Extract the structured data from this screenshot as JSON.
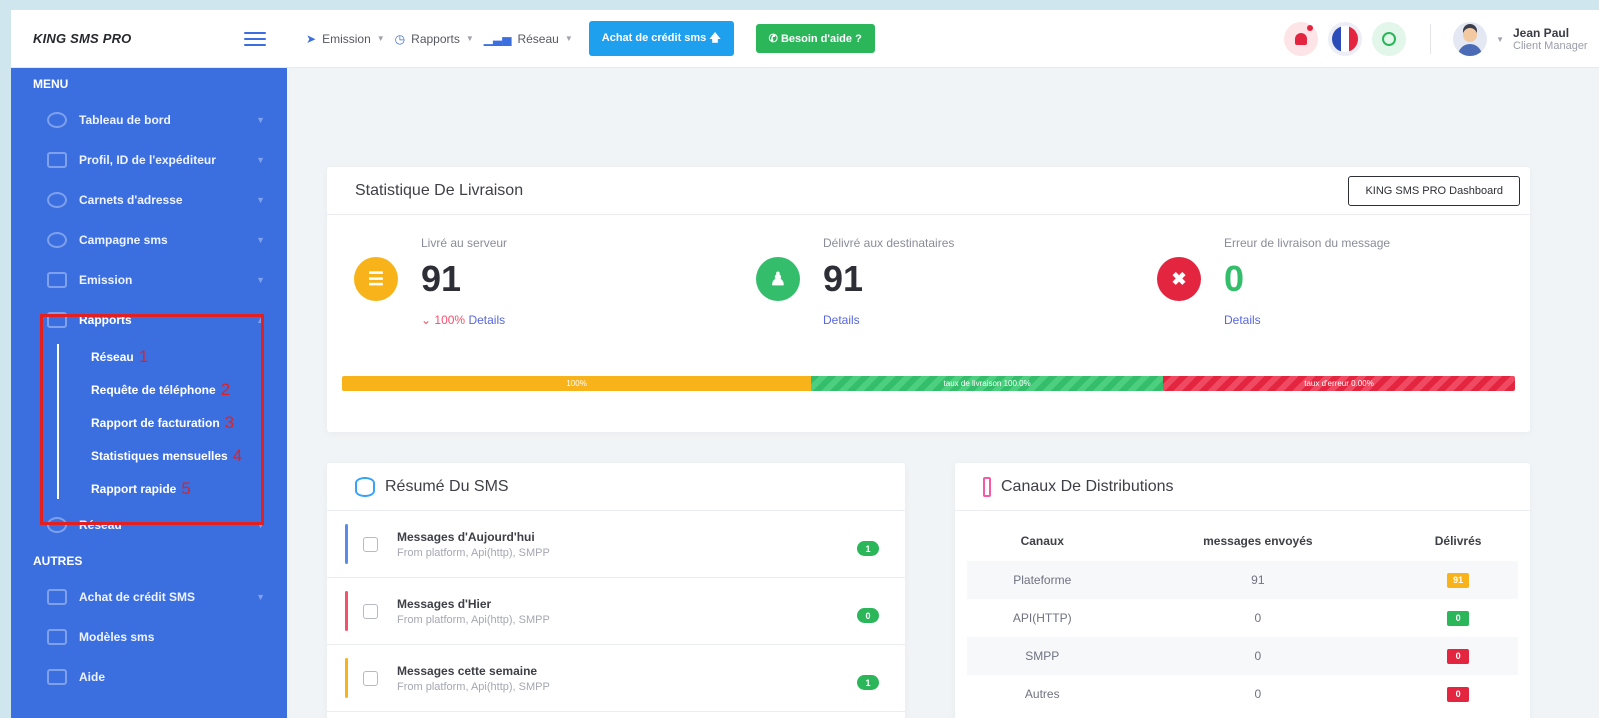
{
  "brand": {
    "name": "KING SMS PRO"
  },
  "topnav": {
    "items": [
      {
        "label": "Emission",
        "icon": "send-icon"
      },
      {
        "label": "Rapports",
        "icon": "clock-icon"
      },
      {
        "label": "Réseau",
        "icon": "signal-icon"
      }
    ],
    "credit_button": "Achat de crédit sms 🡅",
    "help_button": "✆ Besoin d'aide ?"
  },
  "user": {
    "name": "Jean Paul",
    "role": "Client Manager"
  },
  "sidebar": {
    "menu_header": "MENU",
    "items": [
      {
        "label": "Tableau de bord",
        "icon": "bell-icon"
      },
      {
        "label": "Profil, ID de l'expéditeur",
        "icon": "profile-icon"
      },
      {
        "label": "Carnets d'adresse",
        "icon": "address-book-icon"
      },
      {
        "label": "Campagne sms",
        "icon": "diamond-icon"
      },
      {
        "label": "Emission",
        "icon": "screen-icon"
      },
      {
        "label": "Rapports",
        "icon": "report-icon"
      }
    ],
    "rapports_sub": [
      {
        "label": "Réseau",
        "num": "1"
      },
      {
        "label": "Requête de téléphone",
        "num": "2"
      },
      {
        "label": "Rapport de facturation",
        "num": "3"
      },
      {
        "label": "Statistiques mensuelles",
        "num": "4"
      },
      {
        "label": "Rapport rapide",
        "num": "5"
      }
    ],
    "reseau": {
      "label": "Réseau",
      "icon": "wifi-icon"
    },
    "autres_header": "AUTRES",
    "autres_items": [
      {
        "label": "Achat de crédit SMS",
        "icon": "wallet-icon"
      },
      {
        "label": "Modèles sms",
        "icon": "template-icon"
      },
      {
        "label": "Aide",
        "icon": "help-icon"
      }
    ]
  },
  "stats": {
    "title": "Statistique De Livraison",
    "dashboard_button": "KING SMS PRO Dashboard",
    "items": [
      {
        "label": "Livré au serveur",
        "value": "91",
        "pct": "100%",
        "link": "Details",
        "color": "#f8b31a",
        "icon": "server-icon"
      },
      {
        "label": "Délivré aux destinataires",
        "value": "91",
        "link": "Details",
        "color": "#34bd6b",
        "icon": "person-icon"
      },
      {
        "label": "Erreur de livraison du message",
        "value": "0",
        "link": "Details",
        "color": "#e3253f",
        "icon": "close-icon"
      }
    ],
    "progress": [
      {
        "label": "100%",
        "fraction": 0.4
      },
      {
        "label": "taux de livraison 100.0%",
        "fraction": 0.3
      },
      {
        "label": "taux d'erreur 0.00%",
        "fraction": 0.3
      }
    ]
  },
  "sms_summary": {
    "title": "Résumé Du SMS",
    "rows": [
      {
        "title": "Messages d'Aujourd'hui",
        "subtitle": "From platform, Api(http), SMPP",
        "count": "1",
        "color": "#5b8de8"
      },
      {
        "title": "Messages d'Hier",
        "subtitle": "From platform, Api(http), SMPP",
        "count": "0",
        "color": "#f4516c"
      },
      {
        "title": "Messages cette semaine",
        "subtitle": "From platform, Api(http), SMPP",
        "count": "1",
        "color": "#f8b31a"
      }
    ]
  },
  "distribution": {
    "title": "Canaux De Distributions",
    "headers": [
      "Canaux",
      "messages envoyés",
      "Délivrés"
    ],
    "rows": [
      {
        "canal": "Plateforme",
        "sent": "91",
        "delivered": "91",
        "badge": "#f8b31a"
      },
      {
        "canal": "API(HTTP)",
        "sent": "0",
        "delivered": "0",
        "badge": "#2bb65a"
      },
      {
        "canal": "SMPP",
        "sent": "0",
        "delivered": "0",
        "badge": "#e3253f"
      },
      {
        "canal": "Autres",
        "sent": "0",
        "delivered": "0",
        "badge": "#e3253f"
      }
    ]
  }
}
